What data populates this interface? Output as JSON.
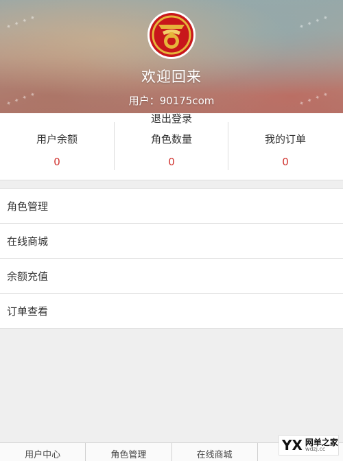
{
  "header": {
    "welcome": "欢迎回来",
    "user_line": "用户：90175com",
    "logout": "退出登录"
  },
  "stats": [
    {
      "label": "用户余额",
      "value": "0"
    },
    {
      "label": "角色数量",
      "value": "0"
    },
    {
      "label": "我的订单",
      "value": "0"
    }
  ],
  "menu": [
    {
      "label": "角色管理"
    },
    {
      "label": "在线商城"
    },
    {
      "label": "余额充值"
    },
    {
      "label": "订单查看"
    }
  ],
  "bottom_nav": [
    {
      "label": "用户中心"
    },
    {
      "label": "角色管理"
    },
    {
      "label": "在线商城"
    },
    {
      "label": ""
    }
  ],
  "badge": {
    "mark": "YX",
    "title": "网单之家",
    "url": "wdzj.cc"
  },
  "colors": {
    "value_red": "#d0312d",
    "logo_red": "#c8171b",
    "logo_gold": "#e6b53a"
  }
}
